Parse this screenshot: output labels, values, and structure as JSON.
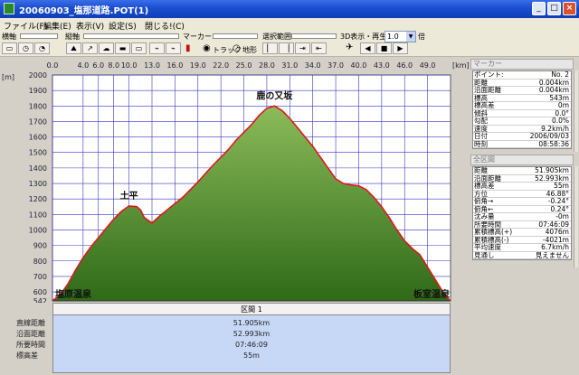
{
  "window": {
    "title": "20060903_塩那道路.POT(1)",
    "min": "_",
    "max": "□",
    "close": "×"
  },
  "menu": [
    "ファイル(F)",
    "編集(E)",
    "表示(V)",
    "設定(S)",
    "閉じる!(C)"
  ],
  "toolbar": {
    "horizontal_label": "横軸",
    "vertical_label": "縦軸",
    "marker_label": "マーカー",
    "range_label": "選択範囲",
    "view3d_label": "3D表示・再生",
    "speed_value": "1.0",
    "speed_unit": "倍",
    "track_option": "トラック",
    "terrain_option": "地形",
    "track_selected": true
  },
  "chart_data": {
    "type": "area",
    "x_unit": "[km]",
    "y_unit": "[m]",
    "xlim": [
      0,
      52
    ],
    "ylim": [
      542,
      2000
    ],
    "x_ticks": [
      0.0,
      4.0,
      6.0,
      8.0,
      10.0,
      13.0,
      16.0,
      19.0,
      22.0,
      25.0,
      28.0,
      31.0,
      34.0,
      37.0,
      40.0,
      43.0,
      46.0,
      49.0
    ],
    "x_tick_labels": [
      "0.0",
      "4.0",
      "6.0",
      "8.0",
      "10.0",
      "13.0",
      "16.0",
      "19.0",
      "22.0",
      "25.0",
      "28.0",
      "31.0",
      "34.0",
      "37.0",
      "40.0",
      "43.0",
      "46.0",
      "49.0"
    ],
    "y_ticks": [
      542,
      600,
      700,
      800,
      900,
      1000,
      1100,
      1200,
      1300,
      1400,
      1500,
      1600,
      1700,
      1800,
      1900,
      2000
    ],
    "x": [
      0,
      1,
      2,
      3,
      4,
      5,
      6,
      7,
      8,
      9,
      10,
      11,
      11.5,
      12,
      13,
      14,
      15,
      16,
      17,
      18,
      19,
      20,
      21,
      22,
      23,
      24,
      25,
      26,
      27,
      28,
      29,
      30,
      31,
      32,
      33,
      34,
      35,
      36,
      37,
      38,
      39,
      40,
      41,
      42,
      43,
      44,
      45,
      46,
      47,
      48,
      49,
      50,
      51,
      51.9
    ],
    "y": [
      543,
      580,
      650,
      740,
      820,
      890,
      950,
      1010,
      1070,
      1120,
      1155,
      1150,
      1130,
      1080,
      1045,
      1090,
      1130,
      1170,
      1210,
      1260,
      1310,
      1365,
      1420,
      1470,
      1520,
      1580,
      1630,
      1680,
      1740,
      1785,
      1800,
      1770,
      1720,
      1660,
      1600,
      1540,
      1470,
      1400,
      1330,
      1300,
      1290,
      1285,
      1260,
      1210,
      1150,
      1080,
      1000,
      930,
      880,
      840,
      760,
      680,
      600,
      543
    ],
    "annotations": [
      {
        "label": "塩原温泉",
        "x": 0,
        "y": 542
      },
      {
        "label": "土平",
        "x": 10,
        "y": 1155
      },
      {
        "label": "鹿の又坂",
        "x": 29,
        "y": 1800
      },
      {
        "label": "板室温泉",
        "x": 51.9,
        "y": 542
      }
    ],
    "line_color": "#e01818",
    "fill_top_color": "#8cbb5a",
    "fill_bottom_color": "#2f6a18",
    "plot_background": "#ffffff",
    "grid_color": "#3838c8",
    "grid": true
  },
  "summary": {
    "header": "区間 1",
    "row_labels": [
      "直線距離",
      "沿面距離",
      "所要時間",
      "標高差"
    ],
    "values": [
      "51.905km",
      "52.993km",
      "07:46:09",
      "55m"
    ]
  },
  "marker_panel": {
    "header": "マーカー",
    "rows": [
      {
        "k": "ポイント:",
        "v": "No. 2"
      },
      {
        "k": "距離",
        "v": "0.004km"
      },
      {
        "k": "沿面距離",
        "v": "0.004km"
      },
      {
        "k": "標高",
        "v": "543m"
      },
      {
        "k": "標高差",
        "v": "0m"
      },
      {
        "k": "傾斜",
        "v": "0.0°"
      },
      {
        "k": "勾配",
        "v": "0.0%"
      },
      {
        "k": "速度",
        "v": "9.2km/h"
      },
      {
        "k": "日付",
        "v": "2006/09/03"
      },
      {
        "k": "時刻",
        "v": "08:58:36"
      }
    ]
  },
  "all_panel": {
    "header": "全区間",
    "rows": [
      {
        "k": "距離",
        "v": "51.905km"
      },
      {
        "k": "沿面距離",
        "v": "52.993km"
      },
      {
        "k": "標高差",
        "v": "55m"
      },
      {
        "k": "方位",
        "v": "46.88°"
      },
      {
        "k": "俯角→",
        "v": "-0.24°"
      },
      {
        "k": "俯角←",
        "v": "0.24°"
      },
      {
        "k": "沈み量",
        "v": "-0m"
      },
      {
        "k": "所要時間",
        "v": "07:46:09"
      },
      {
        "k": "累積標高(+)",
        "v": "4076m"
      },
      {
        "k": "累積標高(-)",
        "v": "-4021m"
      },
      {
        "k": "平均速度",
        "v": "6.7km/h"
      },
      {
        "k": "見通し",
        "v": "見えません"
      }
    ]
  }
}
